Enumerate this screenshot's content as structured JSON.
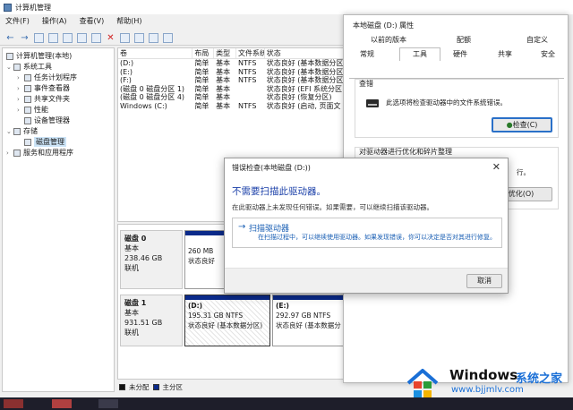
{
  "window": {
    "title": "计算机管理",
    "menu": [
      "文件(F)",
      "操作(A)",
      "查看(V)",
      "帮助(H)"
    ]
  },
  "tree": {
    "root": "计算机管理(本地)",
    "system_tools": "系统工具",
    "items": [
      "任务计划程序",
      "事件查看器",
      "共享文件夹",
      "性能",
      "设备管理器"
    ],
    "storage": "存储",
    "disk_mgmt": "磁盘管理",
    "services": "服务和应用程序"
  },
  "volume_list": {
    "headers": [
      "卷",
      "布局",
      "类型",
      "文件系统",
      "状态"
    ],
    "rows": [
      [
        "(D:)",
        "简单",
        "基本",
        "NTFS",
        "状态良好 (基本数据分区"
      ],
      [
        "(E:)",
        "简单",
        "基本",
        "NTFS",
        "状态良好 (基本数据分区"
      ],
      [
        "(F:)",
        "简单",
        "基本",
        "NTFS",
        "状态良好 (基本数据分区"
      ],
      [
        "(磁盘 0 磁盘分区 1)",
        "简单",
        "基本",
        "",
        "状态良好 (EFI 系统分区"
      ],
      [
        "(磁盘 0 磁盘分区 4)",
        "简单",
        "基本",
        "",
        "状态良好 (恢复分区)"
      ],
      [
        "Windows (C:)",
        "简单",
        "基本",
        "NTFS",
        "状态良好 (启动, 页面文"
      ]
    ]
  },
  "disks": [
    {
      "name": "磁盘 0",
      "type": "基本",
      "size": "238.46 GB",
      "status": "联机",
      "partition": {
        "size": "260 MB",
        "status": "状态良好"
      }
    },
    {
      "name": "磁盘 1",
      "type": "基本",
      "size": "931.51 GB",
      "status": "联机",
      "partitions": [
        {
          "label": "(D:)",
          "size": "195.31 GB NTFS",
          "status": "状态良好 (基本数据分区)"
        },
        {
          "label": "(E:)",
          "size": "292.97 GB NTFS",
          "status": "状态良好 (基本数据分"
        }
      ]
    }
  ],
  "legend": {
    "unallocated": "未分配",
    "primary": "主分区"
  },
  "properties": {
    "title": "本地磁盘 (D:) 属性",
    "tabs_row1": [
      "以前的版本",
      "配额",
      "自定义"
    ],
    "tabs_row2": [
      "常规",
      "工具",
      "硬件",
      "共享",
      "安全"
    ],
    "check_group": "查错",
    "check_desc": "此选项将检查驱动器中的文件系统错误。",
    "check_button": "检查(C)",
    "optimize_group": "对驱动器进行优化和碎片整理",
    "optimize_fragment": "行。",
    "optimize_button": "优化(O)"
  },
  "error_dialog": {
    "title": "错误检查(本地磁盘 (D:))",
    "heading": "不需要扫描此驱动器。",
    "desc": "在此驱动器上未发现任何错误。如果需要，可以继续扫描该驱动器。",
    "scan_title": "扫描驱动器",
    "scan_desc": "在扫描过程中，可以继续使用驱动器。如果发现错误，你可以决定是否对其进行修复。",
    "cancel": "取消"
  },
  "watermark": {
    "brand": "Windows",
    "brand_cn": "系统之家",
    "url": "www.bjjmlv.com"
  },
  "colors": {
    "primary_partition": "#0a2a8a",
    "link_blue": "#1a5fb4",
    "heading_blue": "#1a3fa8",
    "taskbar": "#1e1e2a"
  }
}
